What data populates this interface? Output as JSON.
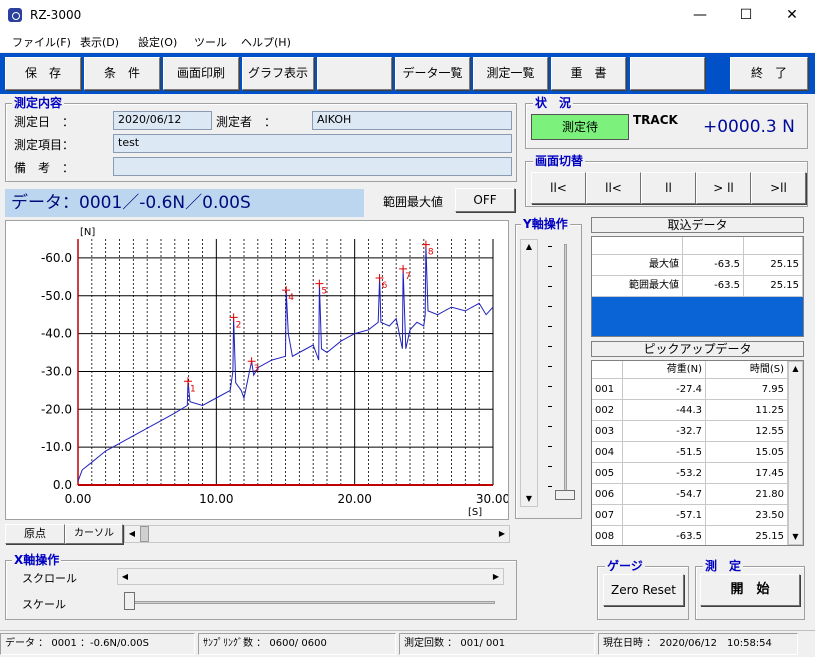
{
  "window": {
    "title": "RZ-3000",
    "min": "—",
    "max": "☐",
    "close": "✕"
  },
  "menu": [
    "ファイル(F)",
    "表示(D)",
    "設定(O)",
    "ツール",
    "ヘルプ(H)"
  ],
  "toolbar": [
    "保　存",
    "条　件",
    "画面印刷",
    "グラフ表示",
    "",
    "データ一覧",
    "測定一覧",
    "重　書",
    "",
    "終　了"
  ],
  "measure_info": {
    "title": "測定内容",
    "date_label": "測定日　：",
    "date": "2020/06/12",
    "operator_label": "測定者　：",
    "operator": "AIKOH",
    "item_label": "測定項目：",
    "item": "test",
    "notes_label": "備　考　：",
    "notes": ""
  },
  "status": {
    "title": "状　況",
    "state": "測定待",
    "mode": "TRACK",
    "value": "+0000.3 N"
  },
  "screen_switch": {
    "title": "画面切替",
    "buttons": [
      "ll<",
      "ll<",
      "ll",
      "> ll",
      ">ll"
    ]
  },
  "data_banner": "データ：0001／-0.6N／0.00S",
  "range_max": {
    "label": "範囲最大値",
    "button": "OFF"
  },
  "y_axis_op": {
    "title": "Y軸操作",
    "up": "▲",
    "down": "▼"
  },
  "capture": {
    "title": "取込データ",
    "rows": [
      {
        "label": "最大値",
        "load": "-63.5",
        "time": "25.15"
      },
      {
        "label": "範囲最大値",
        "load": "-63.5",
        "time": "25.15"
      }
    ]
  },
  "pickup": {
    "title": "ピックアップデータ",
    "headers": [
      "",
      "荷重(N)",
      "時間(S)"
    ],
    "rows": [
      [
        "001",
        "-27.4",
        "7.95"
      ],
      [
        "002",
        "-44.3",
        "11.25"
      ],
      [
        "003",
        "-32.7",
        "12.55"
      ],
      [
        "004",
        "-51.5",
        "15.05"
      ],
      [
        "005",
        "-53.2",
        "17.45"
      ],
      [
        "006",
        "-54.7",
        "21.80"
      ],
      [
        "007",
        "-57.1",
        "23.50"
      ],
      [
        "008",
        "-63.5",
        "25.15"
      ]
    ]
  },
  "chart_buttons": {
    "origin": "原点",
    "cursor": "カーソル"
  },
  "x_axis_op": {
    "title": "X軸操作",
    "scroll": "スクロール",
    "scale": "スケール"
  },
  "gauge": {
    "title": "ゲージ",
    "button": "Zero Reset"
  },
  "measure": {
    "title": "測　定",
    "button": "開　始"
  },
  "statusbar": [
    "データ ： 0001 ：-0.6N/0.00S",
    "ｻﾝﾌﾟﾘﾝｸﾞ数 ： 0600/ 0600",
    "測定回数 ： 001/ 001",
    "現在日時 ： 2020/06/12　10:58:54"
  ],
  "colors": {
    "toolbar": "#0050c8",
    "trace": "#2020c0",
    "peak": "#e00000",
    "highlight": "#0a64d6"
  },
  "chart_data": {
    "type": "line",
    "xlabel": "[S]",
    "ylabel": "[N]",
    "xlim": [
      0,
      30
    ],
    "ylim": [
      0,
      -65
    ],
    "xticks": [
      "0.00",
      "10.00",
      "20.00",
      "30.00"
    ],
    "xtick_values": [
      0,
      10,
      20,
      30
    ],
    "yticks": [
      "-60.0",
      "-50.0",
      "-40.0",
      "-30.0",
      "-20.0",
      "-10.0",
      "0.0"
    ],
    "ytick_values": [
      -60,
      -50,
      -40,
      -30,
      -20,
      -10,
      0
    ],
    "series": [
      {
        "x": [
          0,
          0.3,
          1,
          2,
          3,
          4,
          5,
          6,
          7,
          7.9,
          7.95,
          8.1,
          9,
          10,
          11,
          11.2,
          11.25,
          11.4,
          11.8,
          12,
          12.55,
          12.7,
          13,
          14,
          15,
          15.05,
          15.2,
          15.5,
          16,
          17,
          17.4,
          17.45,
          17.6,
          18,
          19,
          20,
          21,
          21.7,
          21.8,
          21.9,
          22.5,
          23,
          23.45,
          23.5,
          23.7,
          24,
          24.5,
          25,
          25.1,
          25.15,
          25.3,
          26,
          27,
          28,
          29,
          29.5,
          30
        ],
        "y": [
          -1,
          -4,
          -6,
          -9,
          -11,
          -13,
          -15,
          -17,
          -19,
          -21,
          -27.4,
          -22,
          -21,
          -23,
          -25,
          -30,
          -44.3,
          -27,
          -25,
          -23,
          -32.7,
          -29,
          -31,
          -33,
          -34,
          -51.5,
          -40,
          -34,
          -35,
          -37,
          -33,
          -53.2,
          -36,
          -35,
          -38,
          -40,
          -41,
          -43,
          -54.7,
          -43,
          -42,
          -44,
          -36,
          -57.1,
          -36,
          -41,
          -43,
          -42,
          -45,
          -63.5,
          -46,
          -45,
          -47,
          -46,
          -48,
          -45,
          -47
        ]
      }
    ],
    "peak_labels": [
      "1",
      "2",
      "3",
      "4",
      "5",
      "6",
      "7",
      "8"
    ]
  }
}
